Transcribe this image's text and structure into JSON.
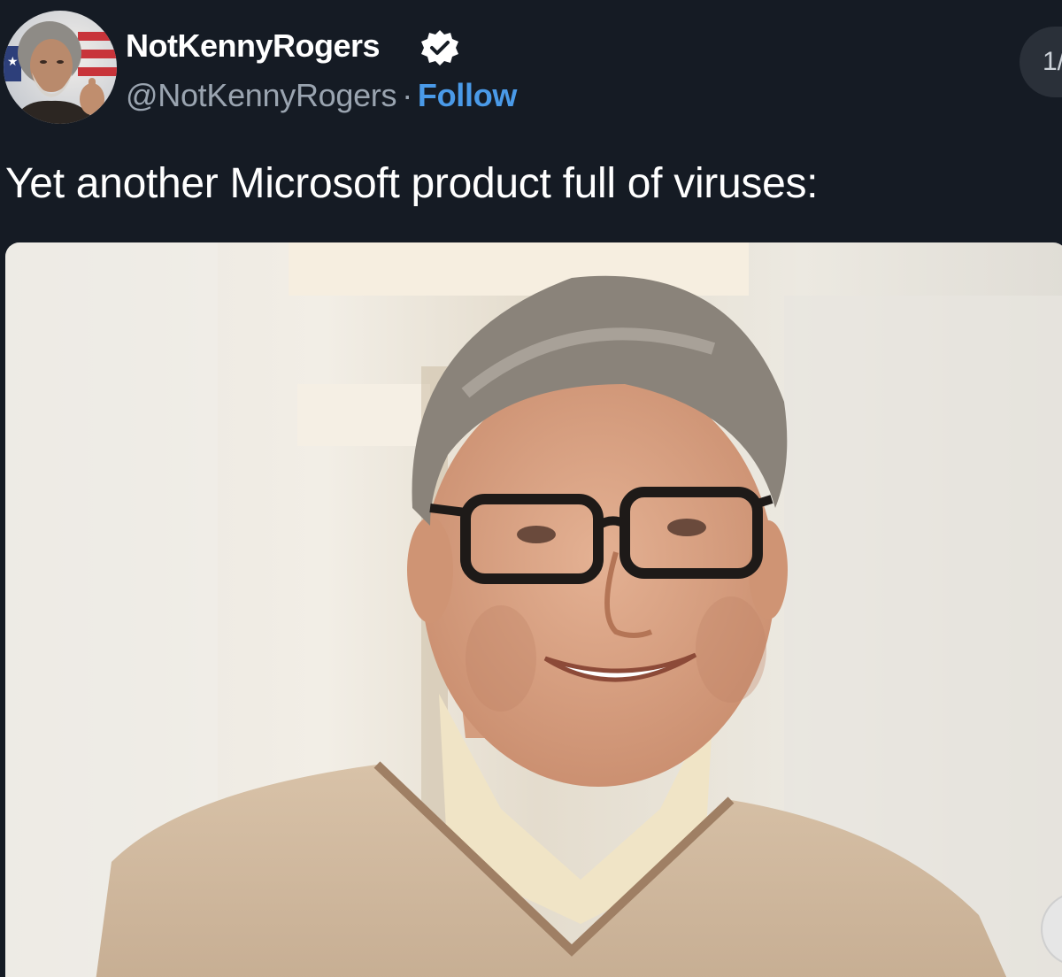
{
  "account": {
    "display_name": "NotKennyRogers",
    "handle": "@NotKennyRogers",
    "separator": "·",
    "follow_label": "Follow",
    "verified": true,
    "verified_color": "#ffffff"
  },
  "tweet": {
    "text": "Yet another Microsoft product full of viruses:"
  },
  "media": {
    "counter_text": "1/"
  },
  "icons": {
    "verified": "verified-badge-icon",
    "carousel_next": "chevron-right-icon"
  },
  "colors": {
    "background": "#151b24",
    "name_text": "#ffffff",
    "handle_text": "#9aa4b0",
    "follow_link": "#4a9ae8",
    "counter_bg": "#2a3039"
  }
}
